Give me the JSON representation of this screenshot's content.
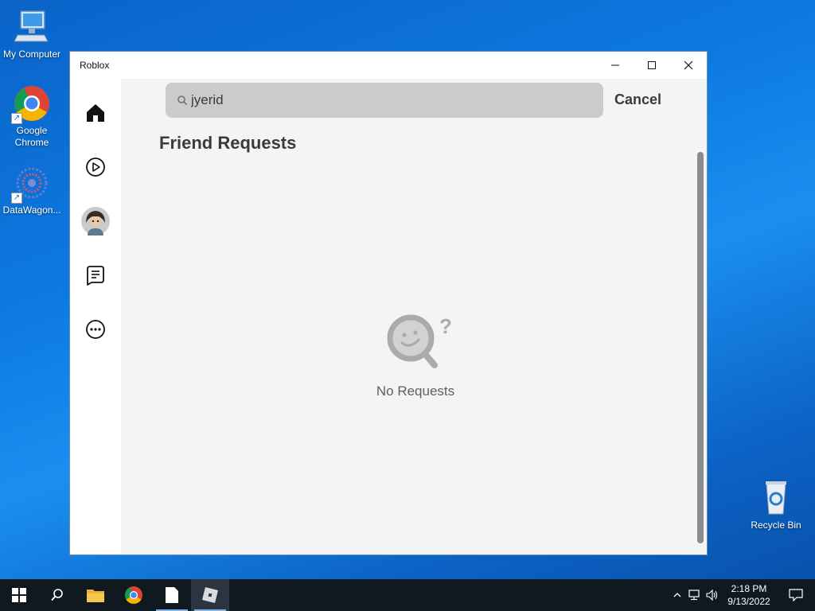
{
  "desktop": {
    "icons": [
      {
        "label": "My Computer"
      },
      {
        "label": "Google Chrome"
      },
      {
        "label": "DataWagon..."
      },
      {
        "label": "Recycle Bin"
      }
    ]
  },
  "window": {
    "title": "Roblox"
  },
  "search": {
    "value": "jyerid",
    "cancel_label": "Cancel"
  },
  "page": {
    "title": "Friend Requests",
    "empty_message": "No Requests"
  },
  "taskbar": {
    "time": "2:18 PM",
    "date": "9/13/2022"
  },
  "colors": {
    "accent": "#0a63c9",
    "window_bg": "#f2f4f5",
    "search_bg": "#c9cbcc",
    "text": "#393b3d"
  }
}
